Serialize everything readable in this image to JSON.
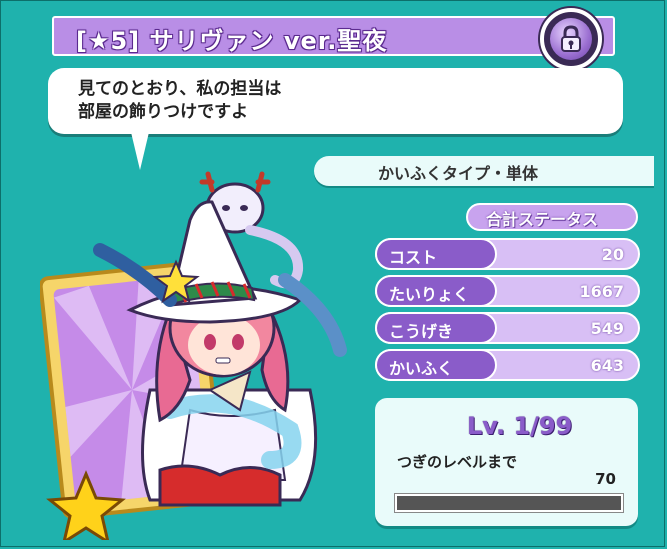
{
  "card": {
    "title": "[★5] サリヴァン ver.聖夜",
    "dialogue": [
      "見てのとおり、私の担当は",
      "部屋の飾りつけですよ"
    ],
    "type": "かいふくタイプ・単体"
  },
  "stats": {
    "heading": "合計ステータス",
    "rows": [
      {
        "label": "コスト",
        "value": "20"
      },
      {
        "label": "たいりょく",
        "value": "1667"
      },
      {
        "label": "こうげき",
        "value": "549"
      },
      {
        "label": "かいふく",
        "value": "643"
      }
    ]
  },
  "level": {
    "text": "Lv. 1/99",
    "next_label": "つぎのレベルまで",
    "next_value": "70",
    "progress": 0
  },
  "icons": {
    "lock": "lock-icon",
    "star": "star-icon"
  },
  "colors": {
    "background": "#1fb2ad",
    "accent": "#8a5cc9",
    "title_bar": "#b98ee6"
  }
}
